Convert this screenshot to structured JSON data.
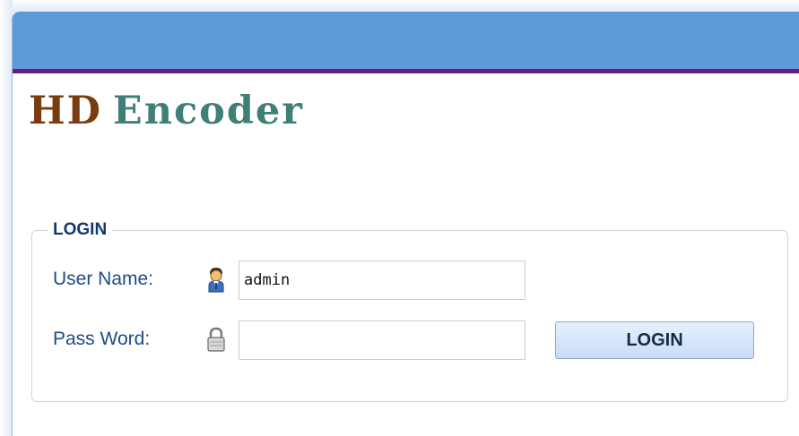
{
  "logo": {
    "part1": "HD",
    "part2": "Encoder"
  },
  "login": {
    "legend": "LOGIN",
    "username_label": "User Name:",
    "username_value": "admin",
    "password_label": "Pass Word:",
    "password_value": "",
    "button_label": "LOGIN"
  },
  "icons": {
    "user": "user-icon",
    "password": "lock-icon"
  },
  "colors": {
    "header_bar": "#5f9ad8",
    "accent_line": "#6c1a8a",
    "logo_hd": "#7a3c0e",
    "logo_encoder": "#3f7f78",
    "label_text": "#1e4b85"
  }
}
